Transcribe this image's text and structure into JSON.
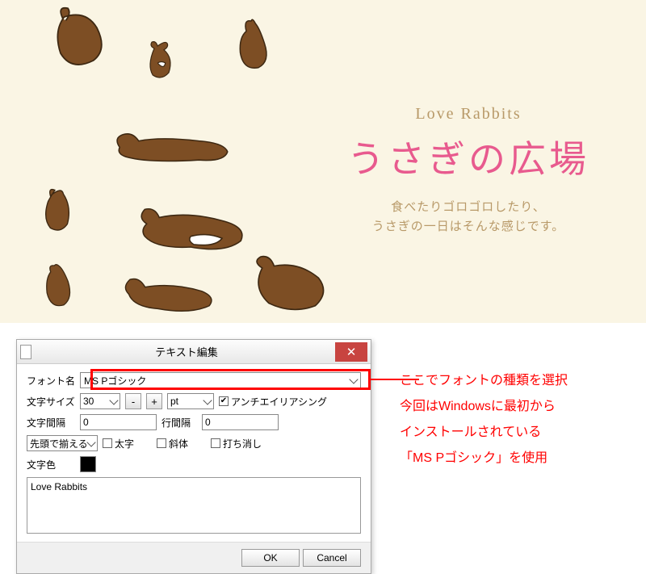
{
  "banner": {
    "subtitle_en": "Love Rabbits",
    "title_jp": "うさぎの広場",
    "desc_line1": "食べたりゴロゴロしたり、",
    "desc_line2": "うさぎの一日はそんな感じです。"
  },
  "dialog": {
    "title": "テキスト編集",
    "labels": {
      "font_name": "フォント名",
      "font_size": "文字サイズ",
      "letter_spacing": "文字間隔",
      "line_spacing": "行間隔",
      "color": "文字色"
    },
    "font_value": "MS Pゴシック",
    "size_value": "30",
    "unit_value": "pt",
    "antialias_label": "アンチエイリアシング",
    "letter_spacing_value": "0",
    "line_spacing_value": "0",
    "align_value": "先頭で揃える",
    "bold_label": "太字",
    "italic_label": "斜体",
    "strike_label": "打ち消し",
    "text_content": "Love Rabbits",
    "ok": "OK",
    "cancel": "Cancel",
    "minus": "-",
    "plus": "+"
  },
  "annotation": {
    "line1": "ここでフォントの種類を選択",
    "line2": "今回はWindowsに最初から",
    "line3": "インストールされている",
    "line4": "「MS Pゴシック」を使用"
  }
}
